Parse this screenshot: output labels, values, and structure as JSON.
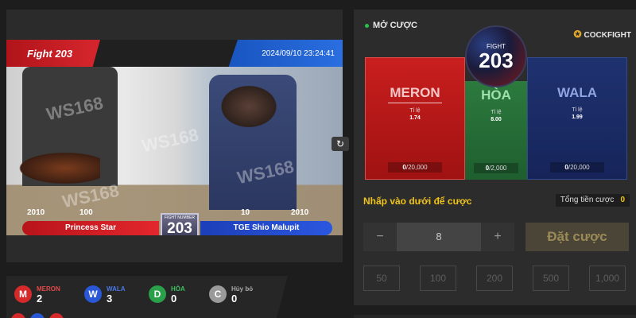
{
  "video": {
    "fight_label": "Fight 203",
    "datetime": "2024/09/10 23:24:41",
    "watermark": "WS168",
    "left_numbers": [
      "2010",
      "100"
    ],
    "right_numbers": [
      "10",
      "2010"
    ],
    "left_name": "Princess Star",
    "right_name": "TGE Shio Malupit",
    "badge_label": "FIGHT NUMBER",
    "badge_number": "203",
    "refresh_icon": "refresh-icon"
  },
  "stats": [
    {
      "letter": "M",
      "label": "MERON",
      "value": "2",
      "color": "#d62a2a"
    },
    {
      "letter": "W",
      "label": "WALA",
      "value": "3",
      "color": "#2a57d6"
    },
    {
      "letter": "D",
      "label": "HÒA",
      "value": "0",
      "color": "#2aa04a"
    },
    {
      "letter": "C",
      "label": "Hủy bỏ",
      "value": "0",
      "color": "#9a9a9a"
    }
  ],
  "bet": {
    "open_label": "MỞ CƯỢC",
    "brand": "COCKFIGHT",
    "fight_label": "FIGHT",
    "fight_number": "203",
    "meron": {
      "name": "MERON",
      "odds_label": "Tỉ lệ",
      "odds": "1.74",
      "amount_bold": "0",
      "amount_rest": "/20,000"
    },
    "hoa": {
      "name": "HÒA",
      "odds_label": "Tỉ lệ",
      "odds": "8.00",
      "amount_bold": "0",
      "amount_rest": "/2,000"
    },
    "wala": {
      "name": "WALA",
      "odds_label": "Tỉ lệ",
      "odds": "1.99",
      "amount_bold": "0",
      "amount_rest": "/20,000"
    },
    "prompt": "Nhấp vào dưới để cược",
    "total_label": "Tổng tiền cược",
    "total_value": "0",
    "minus": "−",
    "stepper_value": "8",
    "plus": "+",
    "place_label": "Đặt cược",
    "chips": [
      "50",
      "100",
      "200",
      "500",
      "1,000"
    ]
  }
}
